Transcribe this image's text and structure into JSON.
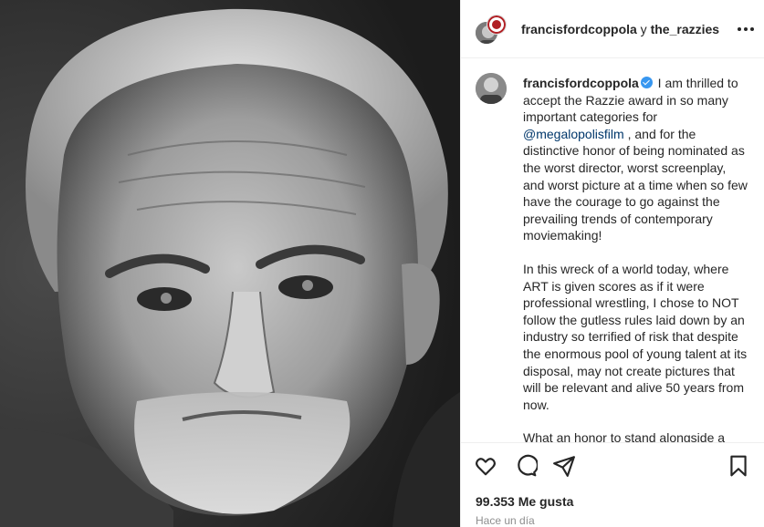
{
  "header": {
    "author": "francisfordcoppola",
    "joiner": " y ",
    "coauthor": "the_razzies"
  },
  "icons": {
    "more": "more-options-icon",
    "verified": "verified-badge-icon",
    "like": "heart-icon",
    "comment": "comment-icon",
    "share": "share-icon",
    "save": "bookmark-icon"
  },
  "caption": {
    "username": "francisfordcoppola",
    "p1_before": " I am thrilled to accept the Razzie award in so many important categories for ",
    "mention": "@megalopolisfilm",
    "p1_after": " , and for the distinctive honor of being nominated as the worst director, worst screenplay, and worst picture at a time when so few have the courage to go against the prevailing trends of contemporary moviemaking!",
    "p2": "In this wreck of a world today, where ART is given scores as if it were professional wrestling, I chose to NOT follow the gutless rules laid down by an industry so terrified of risk that despite the enormous pool of young talent at its disposal, may not create pictures that will be relevant and alive 50 years from now.",
    "p3": "What an honor to stand alongside a"
  },
  "footer": {
    "likes": "99.353 Me gusta",
    "time": "Hace un día"
  },
  "colors": {
    "text": "#262626",
    "mention": "#00376b",
    "verified": "#3897f0",
    "muted": "#8e8e8e"
  }
}
